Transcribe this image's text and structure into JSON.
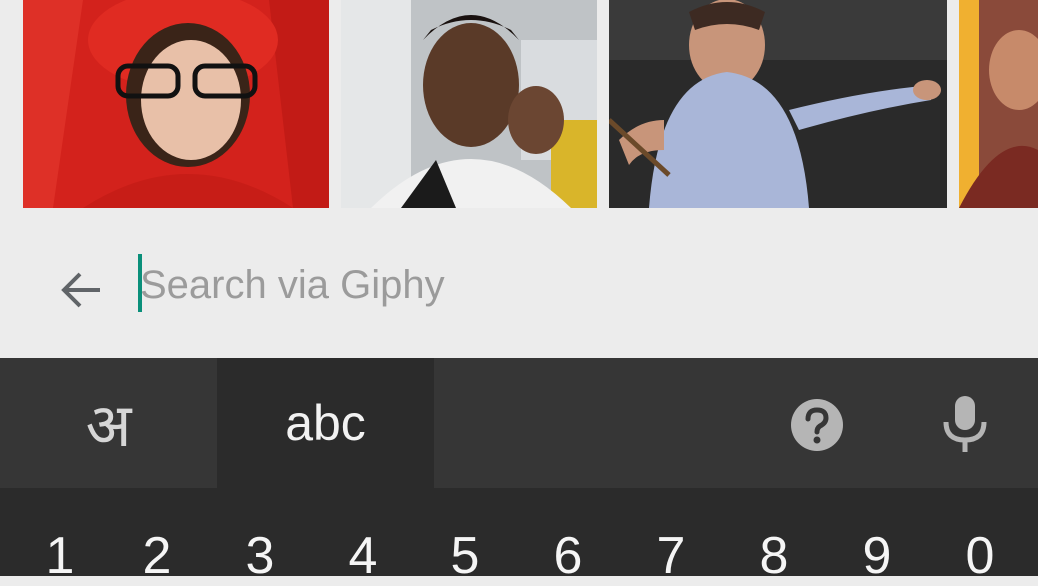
{
  "gifs": [
    {
      "name": "gif-red-glasses-girl"
    },
    {
      "name": "gif-man-talking"
    },
    {
      "name": "gif-wrestler-gesture"
    },
    {
      "name": "gif-partial"
    }
  ],
  "search": {
    "placeholder": "Search via Giphy",
    "value": ""
  },
  "keyboard": {
    "modes": {
      "hindi_label": "अ",
      "abc_label": "abc"
    },
    "icons": {
      "back": "arrow-back-icon",
      "help": "help-icon",
      "mic": "microphone-icon"
    },
    "number_keys": [
      "1",
      "2",
      "3",
      "4",
      "5",
      "6",
      "7",
      "8",
      "9",
      "0"
    ]
  },
  "colors": {
    "accent": "#0a8f7a",
    "background": "#ececec",
    "keyboard": "#2b2b2b"
  }
}
